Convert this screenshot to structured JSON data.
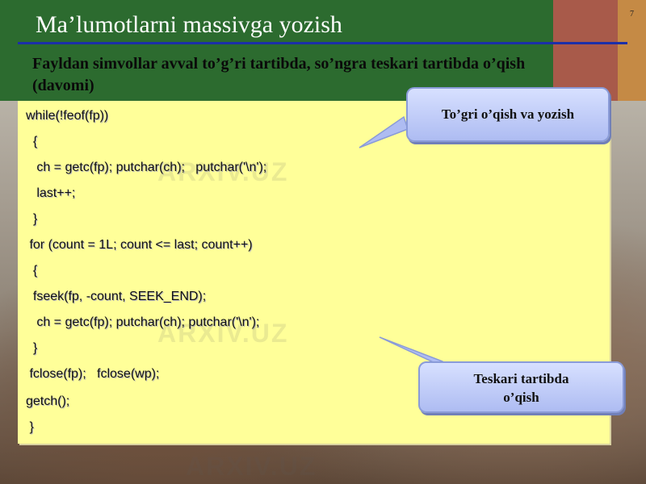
{
  "slide": {
    "page_number": "7",
    "title": "Ma’lumotlarni massivga yozish",
    "subtitle": "Fayldan simvollar avval to’g’ri tartibda, so’ngra teskari tartibda o’qish (davomi)"
  },
  "code": {
    "lines": [
      "while(!feof(fp))",
      "  {",
      "   ch = getc(fp); putchar(ch);   putchar('\\n');",
      "   last++;",
      "  }",
      " for (count = 1L; count <= last; count++)",
      "  {",
      "  fseek(fp, -count, SEEK_END);",
      "   ch = getc(fp); putchar(ch); putchar('\\n');",
      "  }",
      " fclose(fp);   fclose(wp);",
      "getch();",
      " }"
    ]
  },
  "callouts": {
    "top": "To’gri o’qish va yozish",
    "bottom_line1": "Teskari tartibda",
    "bottom_line2": "o’qish"
  },
  "watermark": "ARXIV.UZ",
  "colors": {
    "header_green": "#2c6b2f",
    "accent_line": "#1c2fa8",
    "code_background": "#ffff99",
    "callout_fill": "#c2cdf9"
  }
}
